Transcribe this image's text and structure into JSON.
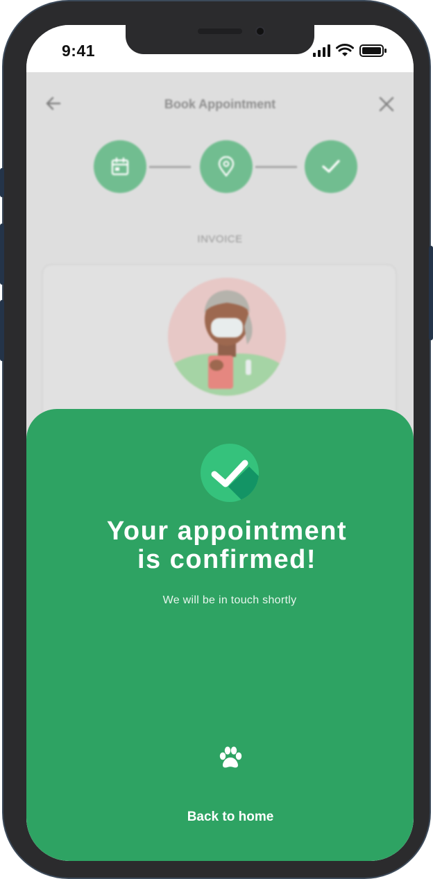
{
  "status": {
    "time": "9:41"
  },
  "nav": {
    "title": "Book Appointment"
  },
  "invoice": {
    "label": "INVOICE"
  },
  "confirmation": {
    "title": "Your appointment\n is confirmed!",
    "subtitle": "We will be in touch shortly",
    "back_label": "Back to home"
  },
  "icons": [
    "back-arrow-icon",
    "close-icon",
    "calendar-icon",
    "location-pin-icon",
    "check-icon",
    "paw-icon",
    "cellular-signal-icon",
    "wifi-icon",
    "battery-icon"
  ],
  "colors": {
    "accent": "#2ea363",
    "step": "#6cbc8c",
    "badge": "#34c17a"
  }
}
